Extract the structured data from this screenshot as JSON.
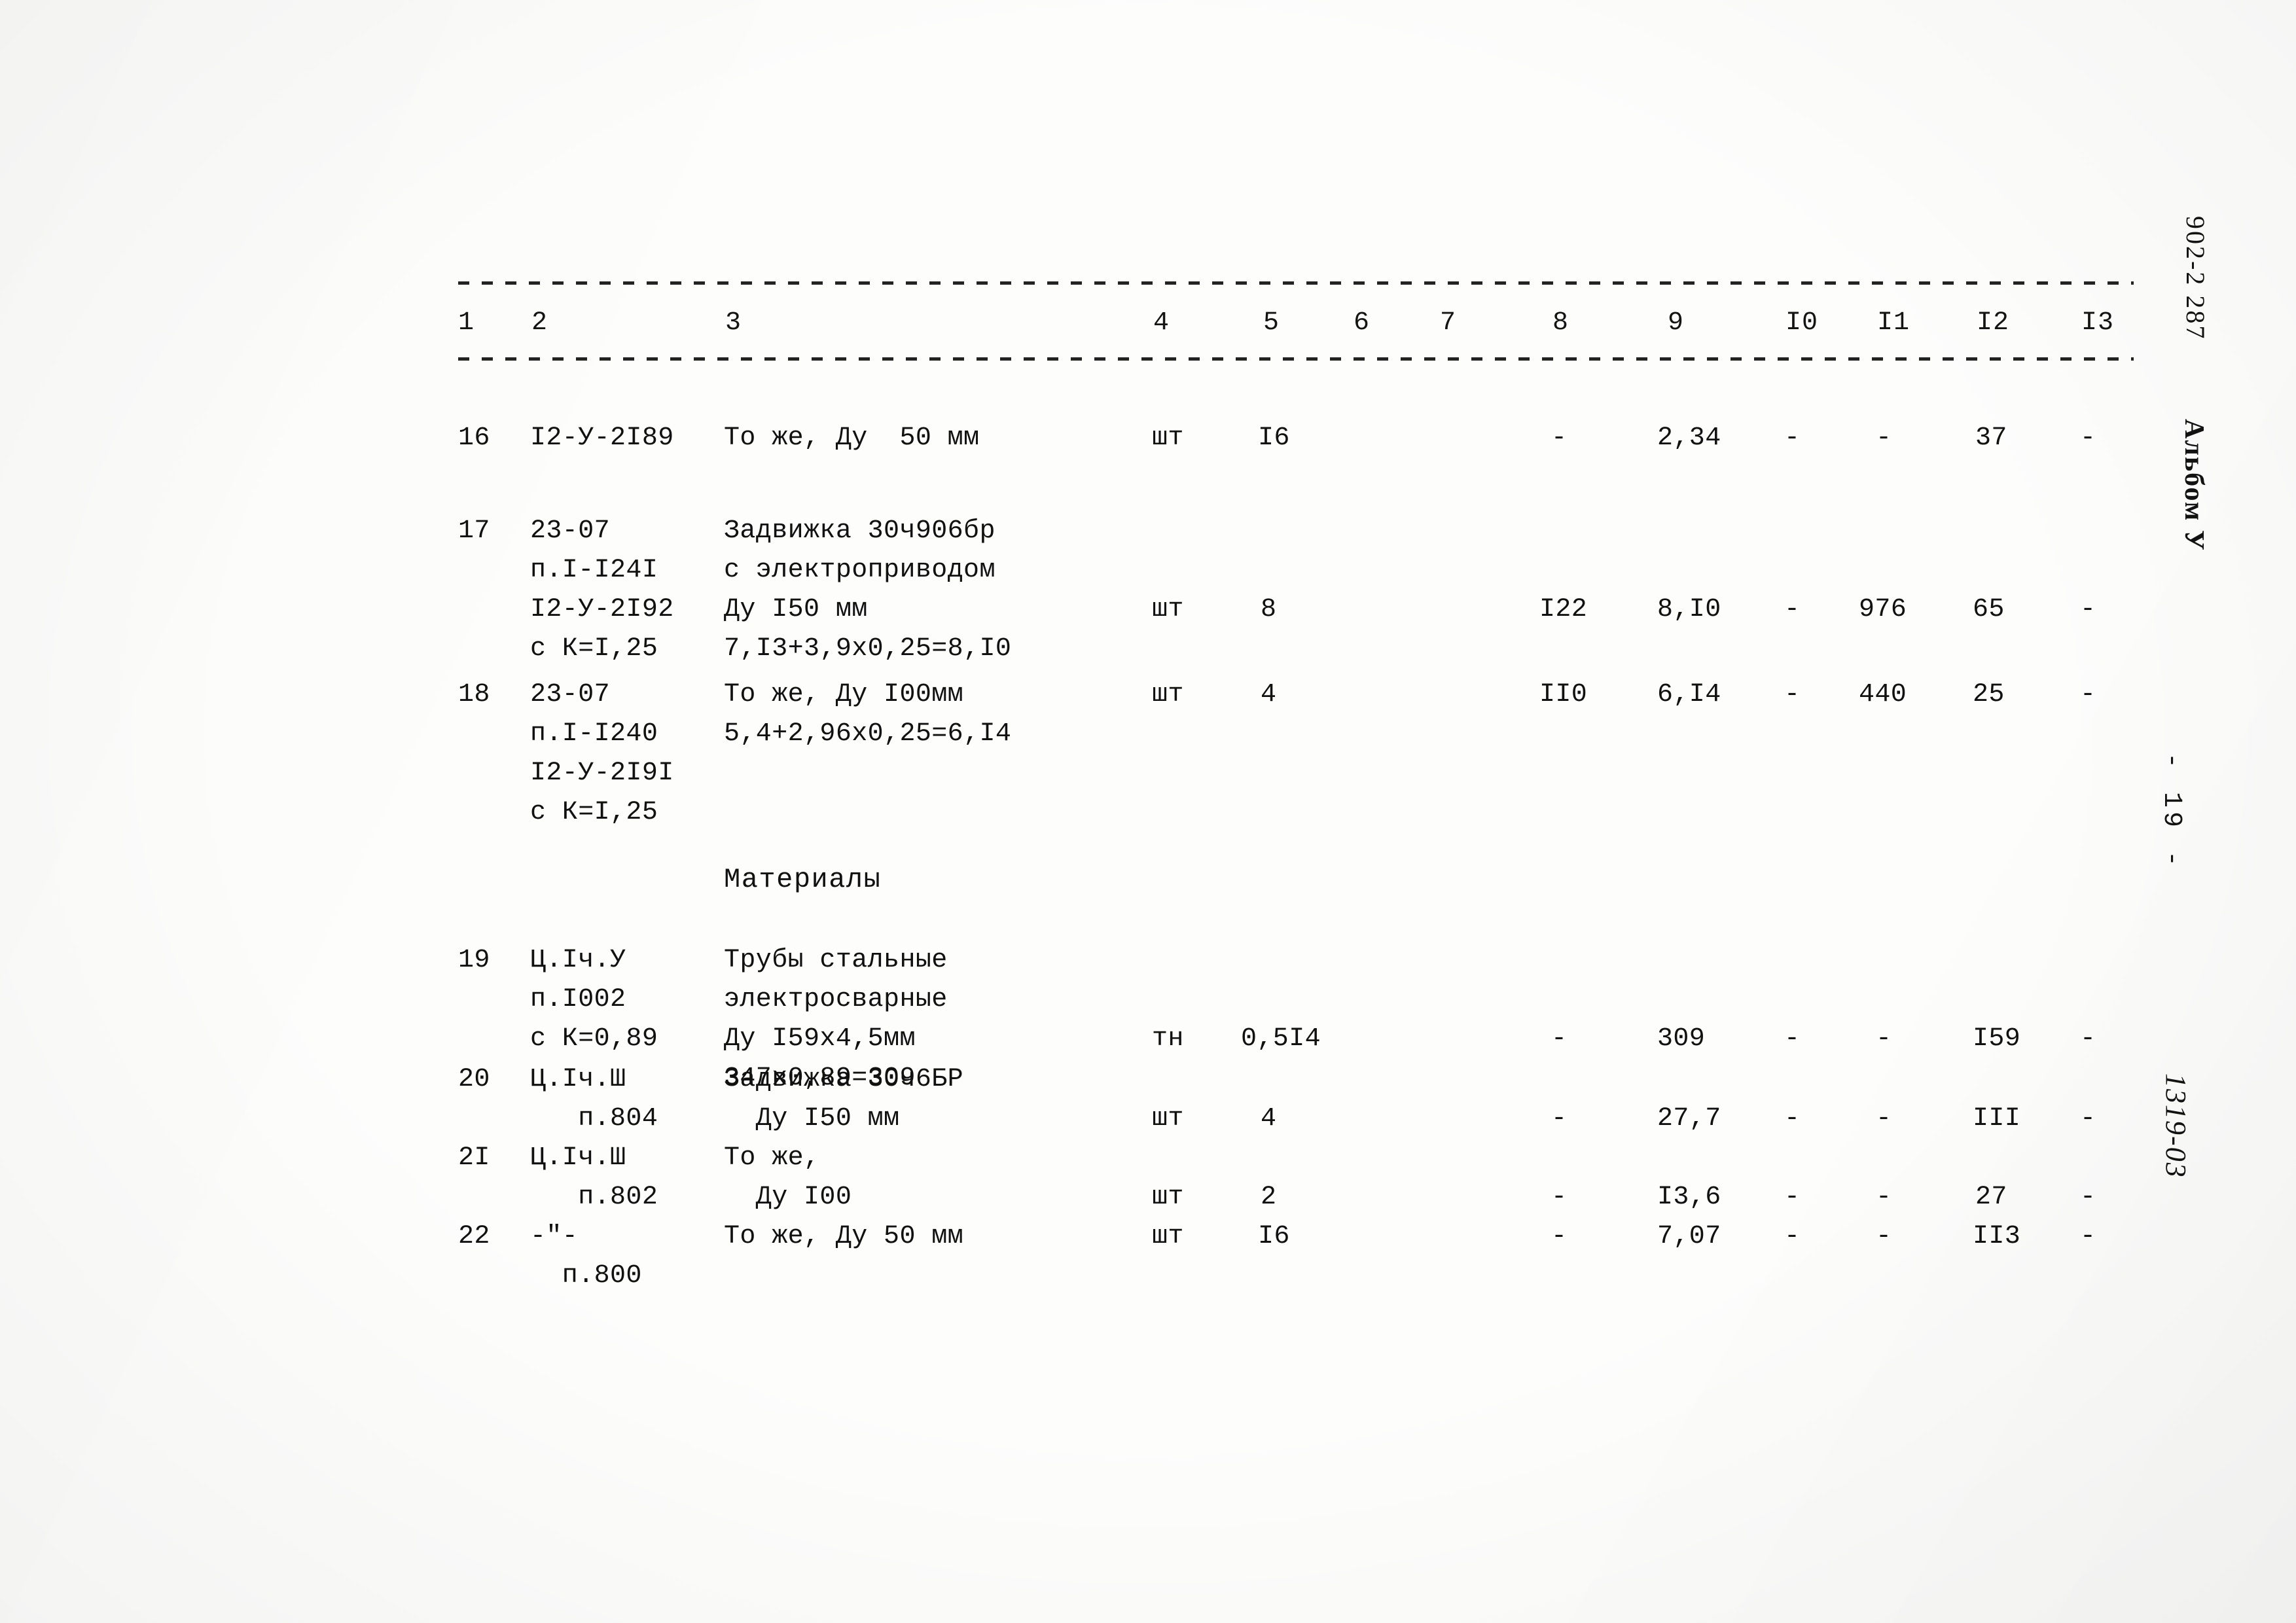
{
  "document": {
    "type": "estimate-table",
    "section_title": "Материалы"
  },
  "table": {
    "column_headers": [
      "1",
      "2",
      "3",
      "4",
      "5",
      "6",
      "7",
      "8",
      "9",
      "I0",
      "I1",
      "I2",
      "I3"
    ],
    "rows": [
      {
        "no": "16",
        "code": "I2-У-2I89",
        "description": "То же, Ду  50 мм",
        "unit": "шт",
        "qty": "I6",
        "c6": "",
        "c7": "",
        "c8": "-",
        "c9": "2,34",
        "c10": "-",
        "c11": "-",
        "c12": "37",
        "c13": "-"
      },
      {
        "no": "17",
        "code": "23-07\nп.I-I24I\nI2-У-2I92\nс К=I,25",
        "description": "Задвижка 30ч906бр\nс электроприводом\nДу I50 мм\n7,I3+3,9х0,25=8,I0",
        "unit": "шт",
        "qty": "8",
        "c6": "",
        "c7": "",
        "c8": "I22",
        "c9": "8,I0",
        "c10": "-",
        "c11": "976",
        "c12": "65",
        "c13": "-"
      },
      {
        "no": "18",
        "code": "23-07\nп.I-I240\nI2-У-2I9I\nс К=I,25",
        "description": "То же, Ду I00мм\n5,4+2,96х0,25=6,I4",
        "unit": "шт",
        "qty": "4",
        "c6": "",
        "c7": "",
        "c8": "II0",
        "c9": "6,I4",
        "c10": "-",
        "c11": "440",
        "c12": "25",
        "c13": "-"
      },
      {
        "no": "19",
        "code": "Ц.Iч.У\nп.I002\nс К=0,89",
        "description": "Трубы стальные\nэлектросварные\nДу I59х4,5мм\n347х0,89=309",
        "unit": "тн",
        "qty": "0,5I4",
        "c6": "",
        "c7": "",
        "c8": "-",
        "c9": "309",
        "c10": "-",
        "c11": "-",
        "c12": "I59",
        "c13": "-"
      },
      {
        "no": "20",
        "code": "Ц.Iч.Ш\n   п.804",
        "description": "Задвижка 30ч6БР\n  Ду I50 мм",
        "unit": "шт",
        "qty": "4",
        "c6": "",
        "c7": "",
        "c8": "-",
        "c9": "27,7",
        "c10": "-",
        "c11": "-",
        "c12": "III",
        "c13": "-"
      },
      {
        "no": "2I",
        "code": "Ц.Iч.Ш\n   п.802",
        "description": "То же,\n  Ду I00",
        "unit": "шт",
        "qty": "2",
        "c6": "",
        "c7": "",
        "c8": "-",
        "c9": "I3,6",
        "c10": "-",
        "c11": "-",
        "c12": "27",
        "c13": "-"
      },
      {
        "no": "22",
        "code": "-\"-\n  п.800",
        "description": "То же, Ду 50 мм",
        "unit": "шт",
        "qty": "I6",
        "c6": "",
        "c7": "",
        "c8": "-",
        "c9": "7,07",
        "c10": "-",
        "c11": "-",
        "c12": "II3",
        "c13": "-"
      }
    ]
  },
  "margin": {
    "doc_code": "902-2 287",
    "album_label": "Альбом У",
    "page_number": "- 19 -",
    "hand_note": "1319-03"
  }
}
